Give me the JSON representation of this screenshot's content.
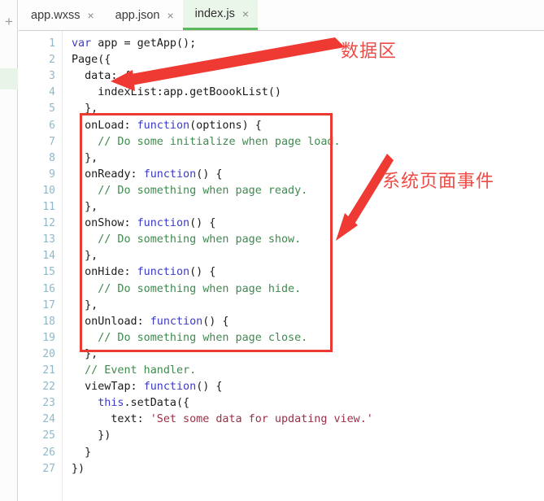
{
  "window": {
    "title": "index.js"
  },
  "left_rail": {
    "new_file_label": "+",
    "new_file_icon": "plus-icon"
  },
  "tabs": [
    {
      "label": "app.wxss",
      "close": "×",
      "active": false
    },
    {
      "label": "app.json",
      "close": "×",
      "active": false
    },
    {
      "label": "index.js",
      "close": "×",
      "active": true
    }
  ],
  "editor": {
    "line_numbers": [
      "1",
      "2",
      "3",
      "4",
      "5",
      "6",
      "7",
      "8",
      "9",
      "10",
      "11",
      "12",
      "13",
      "14",
      "15",
      "16",
      "17",
      "18",
      "19",
      "20",
      "21",
      "22",
      "23",
      "24",
      "25",
      "26",
      "27"
    ],
    "lines": [
      {
        "n": "1",
        "text": "var app = getApp();"
      },
      {
        "n": "2",
        "text": "Page({"
      },
      {
        "n": "3",
        "text": "  data: {"
      },
      {
        "n": "4",
        "text": "    indexList:app.getBoookList()"
      },
      {
        "n": "5",
        "text": "  },"
      },
      {
        "n": "6",
        "text": "  onLoad: function(options) {"
      },
      {
        "n": "7",
        "text": "    // Do some initialize when page load."
      },
      {
        "n": "8",
        "text": "  },"
      },
      {
        "n": "9",
        "text": "  onReady: function() {"
      },
      {
        "n": "10",
        "text": "    // Do something when page ready."
      },
      {
        "n": "11",
        "text": "  },"
      },
      {
        "n": "12",
        "text": "  onShow: function() {"
      },
      {
        "n": "13",
        "text": "    // Do something when page show."
      },
      {
        "n": "14",
        "text": "  },"
      },
      {
        "n": "15",
        "text": "  onHide: function() {"
      },
      {
        "n": "16",
        "text": "    // Do something when page hide."
      },
      {
        "n": "17",
        "text": "  },"
      },
      {
        "n": "18",
        "text": "  onUnload: function() {"
      },
      {
        "n": "19",
        "text": "    // Do something when page close."
      },
      {
        "n": "20",
        "text": "  },"
      },
      {
        "n": "21",
        "text": "  // Event handler."
      },
      {
        "n": "22",
        "text": "  viewTap: function() {"
      },
      {
        "n": "23",
        "text": "    this.setData({"
      },
      {
        "n": "24",
        "text": "      text: 'Set some data for updating view.'"
      },
      {
        "n": "25",
        "text": "    })"
      },
      {
        "n": "26",
        "text": "  }"
      },
      {
        "n": "27",
        "text": "})"
      }
    ]
  },
  "annotations": {
    "data_area_label": "数据区",
    "page_events_label": "系统页面事件",
    "box_color": "#ea3a32",
    "label_color": "#ee4b45"
  },
  "colors": {
    "accent_green": "#5cb85c",
    "keyword": "#3b3bc4",
    "comment": "#3f8a4f",
    "string": "#9b2f45",
    "gutter_number": "#8fb8c9"
  }
}
